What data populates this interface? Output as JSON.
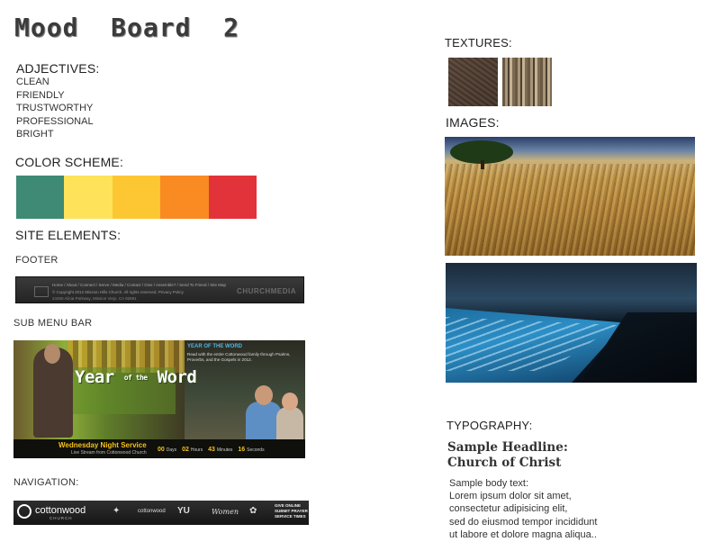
{
  "title": "Mood  Board  2",
  "adjectives": {
    "heading": "ADJECTIVES:",
    "items": [
      "CLEAN",
      "FRIENDLY",
      "TRUSTWORTHY",
      "PROFESSIONAL",
      "BRIGHT"
    ]
  },
  "color_scheme": {
    "heading": "COLOR SCHEME:",
    "swatches": [
      "#3f8a74",
      "#fde25a",
      "#fdc733",
      "#fa8a22",
      "#e3333a"
    ]
  },
  "site_elements": {
    "heading": "SITE ELEMENTS:",
    "footer": {
      "label": "FOOTER",
      "links": "Home / About / Connect / Serve / Media / Contact / Give / Assemble? / Send To Friend / Site Map",
      "copyright": "© Copyright 2012 Mission Hills Church. All rights reserved.   Privacy Policy",
      "address": "24450 Alicia Parkway, Mission Viejo, CA 92691",
      "brand": "CHURCHMEDIA"
    },
    "sub_menu": {
      "label": "SUB MENU BAR",
      "banner_title": "Year",
      "banner_of_the": "of the",
      "banner_word": "Word",
      "heading": "YEAR OF THE WORD",
      "description": "Read with the entire Cottonwood family through Psalms, Proverbs, and the Gospels in 2012.",
      "event": "Wednesday Night Service",
      "live": "Live Stream from Cottonwood Church",
      "countdown": [
        {
          "value": "00",
          "unit": "Days"
        },
        {
          "value": "02",
          "unit": "Hours"
        },
        {
          "value": "43",
          "unit": "Minutes"
        },
        {
          "value": "16",
          "unit": "Seconds"
        }
      ]
    },
    "navigation": {
      "label": "NAVIGATION:",
      "logo": "cottonwood",
      "logo_sub": "CHURCH",
      "item_cottonwood": "cottonwood",
      "item_youth": "YU",
      "item_women": "Women",
      "side_links": [
        "GIVE ONLINE",
        "SUBMIT PRAYER",
        "SERVICE TIMES"
      ]
    }
  },
  "textures": {
    "heading": "TEXTURES:"
  },
  "images": {
    "heading": "IMAGES:"
  },
  "typography": {
    "heading": "TYPOGRAPHY:",
    "headline_1": "Sample Headline:",
    "headline_2": "Church of Christ",
    "body": [
      "Sample body text:",
      "Lorem ipsum dolor sit amet,",
      "consectetur adipisicing elit,",
      "sed do eiusmod tempor incididunt",
      "ut labore et dolore magna aliqua.."
    ]
  }
}
